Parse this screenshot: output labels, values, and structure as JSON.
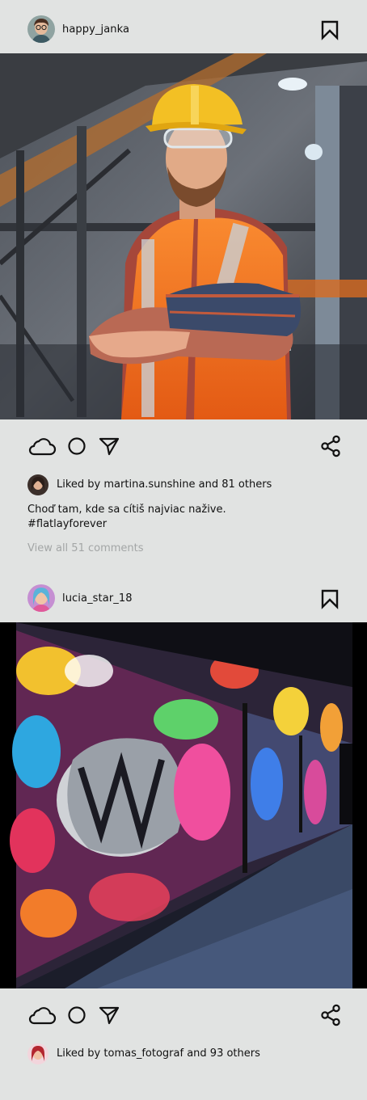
{
  "posts": [
    {
      "username": "happy_janka",
      "photo_description_icon": "photo-construction-worker",
      "likes": {
        "prefix": "Liked by ",
        "user": "martina.sunshine",
        "suffix": " and 81 others"
      },
      "caption_line1": "Choď tam, kde sa cítiš najviac naživе.",
      "caption_line2": "#flatlayforever",
      "view_comments": "View all 51 comments"
    },
    {
      "username": "lucia_star_18",
      "photo_description_icon": "photo-graffiti-wall",
      "likes": {
        "prefix": "Liked by ",
        "user": "tomas_fotograf",
        "suffix": " and 93 others"
      }
    }
  ],
  "icons": {
    "bookmark": "bookmark-icon",
    "like": "cloud-icon",
    "comment": "circle-icon",
    "send": "send-icon",
    "share": "share-icon"
  },
  "colors": {
    "background": "#e1e3e2",
    "text": "#111111",
    "muted": "#a3a6a6",
    "vest": "#f5731d",
    "helmet": "#f3c024"
  }
}
